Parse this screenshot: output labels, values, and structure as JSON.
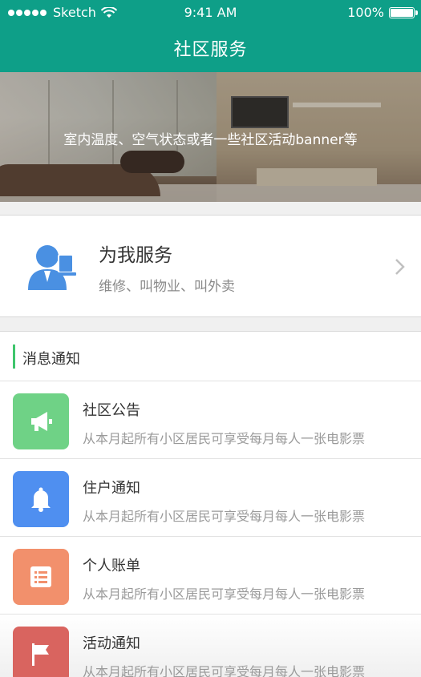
{
  "status_bar": {
    "carrier": "Sketch",
    "time": "9:41 AM",
    "battery": "100%"
  },
  "header": {
    "title": "社区服务"
  },
  "banner": {
    "text": "室内温度、空气状态或者一些社区活动banner等"
  },
  "service": {
    "title": "为我服务",
    "subtitle": "维修、叫物业、叫外卖",
    "icon": "customer-service-icon",
    "icon_color": "#4a90e2"
  },
  "notices": {
    "section_title": "消息通知",
    "accent_color": "#3fc56c",
    "items": [
      {
        "title": "社区公告",
        "desc": "从本月起所有小区居民可享受每月每人一张电影票",
        "icon": "megaphone-icon",
        "color": "#6fd286"
      },
      {
        "title": "住户通知",
        "desc": "从本月起所有小区居民可享受每月每人一张电影票",
        "icon": "bell-icon",
        "color": "#4f8ff0"
      },
      {
        "title": "个人账单",
        "desc": "从本月起所有小区居民可享受每月每人一张电影票",
        "icon": "bill-icon",
        "color": "#f2906c"
      },
      {
        "title": "活动通知",
        "desc": "从本月起所有小区居民可享受每月每人一张电影票",
        "icon": "flag-icon",
        "color": "#d9645f"
      }
    ]
  }
}
